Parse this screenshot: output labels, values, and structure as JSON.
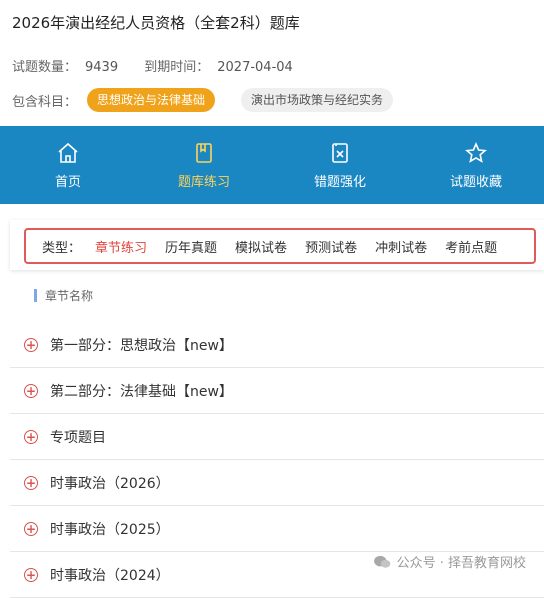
{
  "header": {
    "title": "2026年演出经纪人员资格（全套2科）题库",
    "count_label": "试题数量：",
    "count_value": "9439",
    "expire_label": "到期时间：",
    "expire_value": "2027-04-04",
    "subjects_label": "包含科目：",
    "subjects": [
      "思想政治与法律基础",
      "演出市场政策与经纪实务"
    ]
  },
  "nav": {
    "items": [
      "首页",
      "题库练习",
      "错题强化",
      "试题收藏"
    ],
    "active": 1,
    "active_color": "#ffd45a",
    "bar_color": "#1a86c2"
  },
  "types": {
    "label": "类型：",
    "tabs": [
      "章节练习",
      "历年真题",
      "模拟试卷",
      "预测试卷",
      "冲刺试卷",
      "考前点题"
    ],
    "active": 0
  },
  "section": {
    "title": "章节名称"
  },
  "chapters": [
    "第一部分：思想政治【new】",
    "第二部分：法律基础【new】",
    "专项题目",
    "时事政治（2026）",
    "时事政治（2025）",
    "时事政治（2024）"
  ],
  "watermark": {
    "text": "公众号 · 择吾教育网校"
  }
}
